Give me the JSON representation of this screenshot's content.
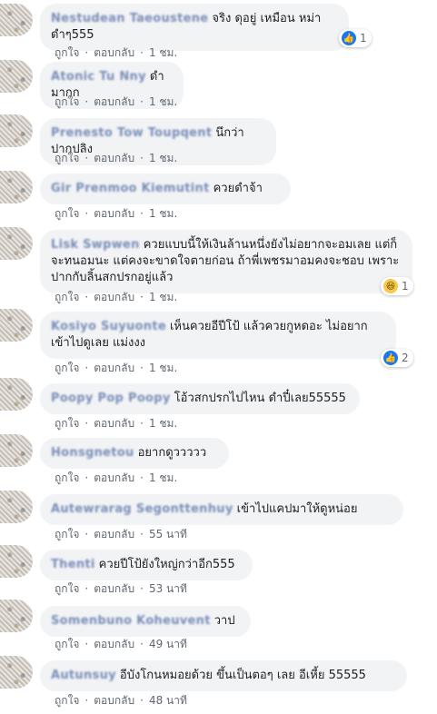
{
  "actions": {
    "like": "ถูกใจ",
    "reply": "ตอบกลับ",
    "sep": "·"
  },
  "comments": [
    {
      "name": "Nestudean Taeoustene",
      "text": "จริง ดุอยู่ เหมือน หม่าดำๆ555",
      "time": "1 ชม.",
      "reaction": {
        "icon": "like-icon",
        "count": "1"
      }
    },
    {
      "name": "Atonic Tu Nny",
      "text": "ดำมากก",
      "time": "1 ชม."
    },
    {
      "name": "Prenesto Tow Toupqent",
      "text": "นึกว่าปากปลิง",
      "time": "1 ชม."
    },
    {
      "name": "Gir Prenmoo Kiemutint",
      "text": "ควยดำจ้า",
      "time": "1 ชม."
    },
    {
      "name": "Lisk Swpwen",
      "text": "ควยแบบนี้ให้เงินล้านหนึ่งยังไม่อยากจะอมเลย แต่ก็จะทนอมนะ แต่คงจะขาดใจตายก่อน ถ้าพี่เพชรมาอมคงจะชอบ เพราะปากกับลิ้นสกปรกอยู่แล้ว",
      "time": "1 ชม.",
      "reaction": {
        "icon": "haha-icon",
        "count": "1"
      }
    },
    {
      "name": "Kosiyo Suyuonte",
      "text": "เห็นควยอีปีโป้ แล้วควยกูหดอะ ไม่อยากเข้าไปดูเลย แม่งงง",
      "time": "1 ชม.",
      "reaction": {
        "icon": "like-icon",
        "count": "2"
      }
    },
    {
      "name": "Poopy Pop Poopy",
      "text": "โอ้วสกปรกไปไหน ดำปี๋เลย55555",
      "time": "1 ชม."
    },
    {
      "name": "Honsgnetou",
      "text": "อยากดูววววว",
      "time": "1 ชม."
    },
    {
      "name": "Autewrarag Segonttenhuy",
      "text": "เข้าไปแคปมาให้ดูหน่อย",
      "time": "55 นาที"
    },
    {
      "name": "Thenti",
      "text": "ควยปีโป้ยังใหญ่กว่าอีก555",
      "time": "53 นาที"
    },
    {
      "name": "Somenbuno Koheuvent",
      "text": "วาป",
      "time": "49 นาที"
    },
    {
      "name": "Autunsuy",
      "text": "อีบังโกนหมอยด้วย ขึ้นเป็นตอๆ เลย อีเหี้ย 55555",
      "time": "48 นาที"
    }
  ]
}
